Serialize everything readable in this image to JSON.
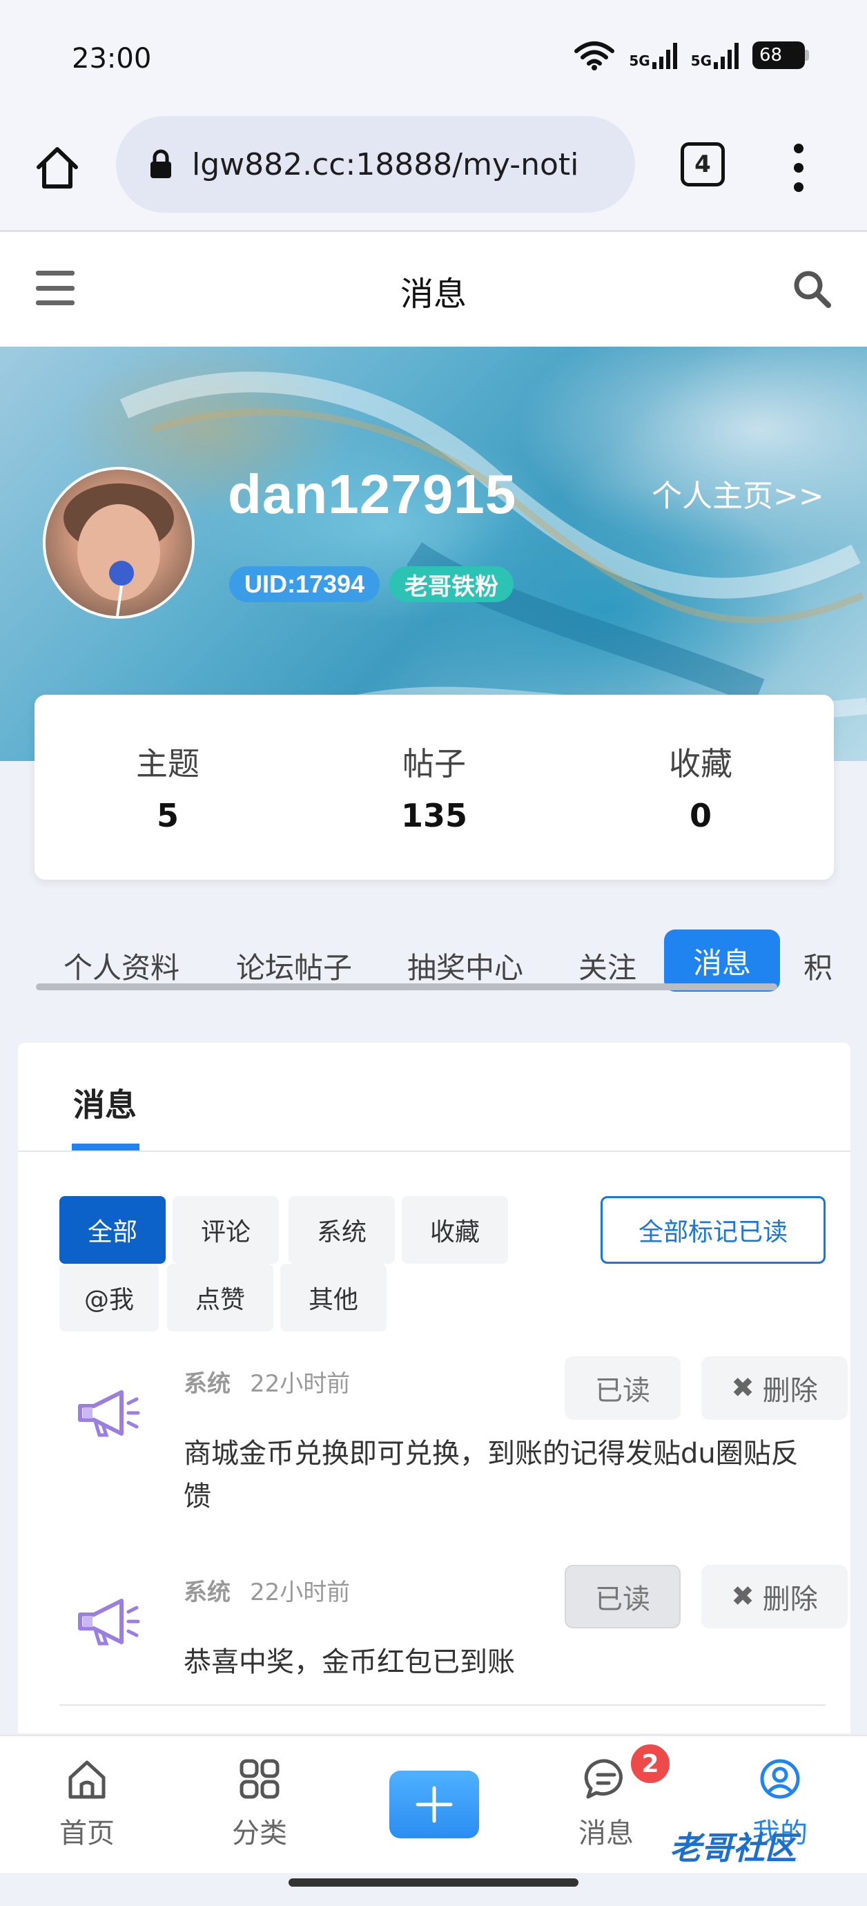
{
  "status_bar": {
    "time": "23:00",
    "network1": "5G",
    "network2": "5G",
    "battery": "68"
  },
  "browser": {
    "url": "lgw882.cc:18888/my-noti",
    "tab_count": "4"
  },
  "header": {
    "title": "消息"
  },
  "profile": {
    "username": "dan127915",
    "homepage_link": "个人主页>>",
    "uid_badge": "UID:17394",
    "fan_badge": "老哥铁粉"
  },
  "stats": [
    {
      "label": "主题",
      "value": "5"
    },
    {
      "label": "帖子",
      "value": "135"
    },
    {
      "label": "收藏",
      "value": "0"
    }
  ],
  "profile_tabs": [
    "个人资料",
    "论坛帖子",
    "抽奖中心",
    "关注",
    "消息",
    "积"
  ],
  "panel": {
    "title": "消息",
    "filters": [
      "全部",
      "评论",
      "系统",
      "收藏",
      "@我",
      "点赞",
      "其他"
    ],
    "mark_all_read": "全部标记已读"
  },
  "messages": [
    {
      "type": "系统",
      "time": "22小时前",
      "text": "商城金币兑换即可兑换，到账的记得发贴du圈贴反馈",
      "read_label": "已读",
      "delete_label": "删除"
    },
    {
      "type": "系统",
      "time": "22小时前",
      "text": "恭喜中奖，金币红包已到账",
      "read_label": "已读",
      "delete_label": "删除"
    }
  ],
  "bottom_nav": {
    "home": "首页",
    "category": "分类",
    "messages": "消息",
    "messages_badge": "2",
    "mine": "我的"
  },
  "watermark": "老哥社区",
  "colors": {
    "accent": "#1f84ef",
    "filter_active": "#0c62c9",
    "badge_red": "#ee4a4a",
    "megaphone": "#9b7fe0"
  }
}
